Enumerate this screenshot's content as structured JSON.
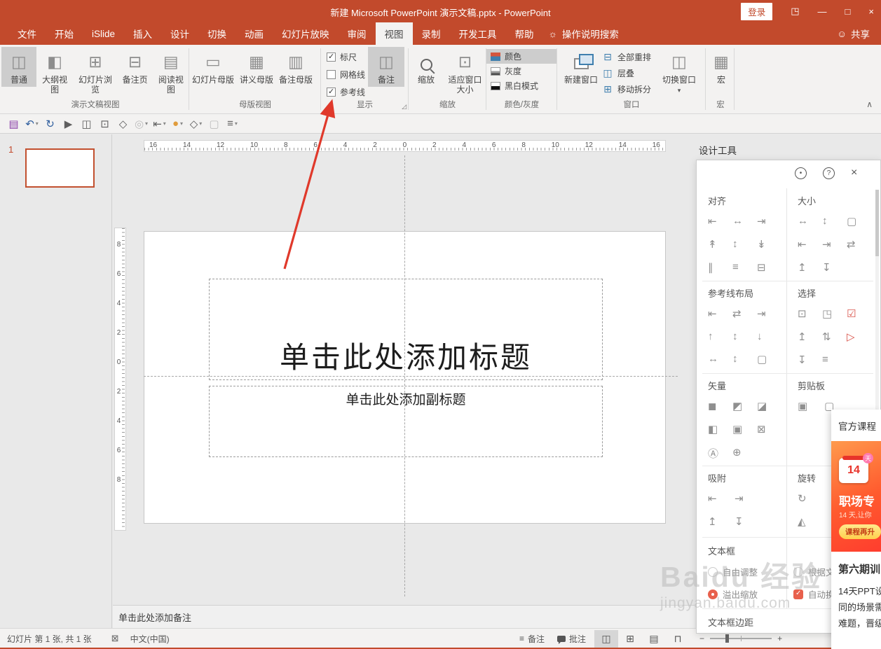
{
  "colors": {
    "titlebar": "#c24a2c",
    "accent": "#c24a2c",
    "selected_gray": "#cdcdcd",
    "panel_red": "#d9534a",
    "guide": "#a8a8a8",
    "promo_orange_start": "#ff9a4d",
    "promo_orange_end": "#ff3d2e",
    "promo_button": "#ffcf4d"
  },
  "titlebar": {
    "title": "新建 Microsoft PowerPoint 演示文稿.pptx  -  PowerPoint",
    "login": "登录",
    "controls": {
      "ribbon_display": "◳",
      "minimize": "—",
      "maximize": "□",
      "close": "×"
    }
  },
  "tabrow": {
    "tabs": [
      {
        "label": "文件"
      },
      {
        "label": "开始"
      },
      {
        "label": "iSlide"
      },
      {
        "label": "插入"
      },
      {
        "label": "设计"
      },
      {
        "label": "切换"
      },
      {
        "label": "动画"
      },
      {
        "label": "幻灯片放映"
      },
      {
        "label": "审阅"
      },
      {
        "label": "视图",
        "mod": "active"
      },
      {
        "label": "录制"
      },
      {
        "label": "开发工具"
      },
      {
        "label": "帮助"
      }
    ],
    "search": {
      "icon": "☼",
      "label": "操作说明搜索"
    },
    "share": {
      "icon": "☺",
      "label": "共享"
    }
  },
  "ribbon": {
    "presentation_views": {
      "label": "演示文稿视图",
      "buttons": [
        {
          "label": "普通",
          "g": "◫",
          "mod": "selected",
          "name": "normal-view-button"
        },
        {
          "label": "大纲视图",
          "g": "◧",
          "name": "outline-view-button"
        },
        {
          "label": "幻灯片浏览",
          "g": "⊞",
          "name": "slide-sorter-button"
        },
        {
          "label": "备注页",
          "g": "⊟",
          "name": "notes-page-button"
        },
        {
          "label": "阅读视图",
          "g": "▤",
          "name": "reading-view-button"
        }
      ]
    },
    "master_views": {
      "label": "母版视图",
      "buttons": [
        {
          "label": "幻灯片母版",
          "g": "▭",
          "name": "slide-master-button"
        },
        {
          "label": "讲义母版",
          "g": "▦",
          "name": "handout-master-button"
        },
        {
          "label": "备注母版",
          "g": "▥",
          "name": "notes-master-button"
        }
      ]
    },
    "show": {
      "label": "显示",
      "checkboxes": [
        {
          "label": "标尺",
          "mod": "checked",
          "name": "ruler-checkbox"
        },
        {
          "label": "网格线",
          "name": "gridlines-checkbox"
        },
        {
          "label": "参考线",
          "mod": "checked",
          "name": "guides-checkbox"
        }
      ],
      "notes": {
        "label": "备注"
      },
      "launcher": "◿"
    },
    "zoom": {
      "label": "缩放",
      "zoom_label": "缩放",
      "fit_label": "适应窗口大小",
      "fit_g": "⊡"
    },
    "color_gray": {
      "label": "颜色/灰度",
      "items_color": "颜色",
      "items_gray": "灰度",
      "items_bw": "黑白模式"
    },
    "window": {
      "label": "窗口",
      "new_window": "新建窗口",
      "items": [
        {
          "label": "全部重排",
          "g": "⊟",
          "name": "arrange-all-button"
        },
        {
          "label": "层叠",
          "g": "◫",
          "name": "cascade-button"
        },
        {
          "label": "移动拆分",
          "g": "⊞",
          "name": "move-split-button"
        }
      ],
      "switch_label": "切换窗口",
      "caret": "▾"
    },
    "macro": {
      "label": "宏",
      "button": "宏",
      "g": "▦"
    },
    "collapse": "∧"
  },
  "qat": {
    "items": [
      {
        "g": "▤",
        "name": "save-icon",
        "mod": "purple"
      },
      {
        "g": "↶",
        "name": "undo-icon",
        "mod": "blue caret"
      },
      {
        "g": "↻",
        "name": "redo-icon",
        "mod": "blue"
      },
      {
        "g": "▶",
        "name": "start-slideshow-icon"
      },
      {
        "g": "◫",
        "name": "notes-icon"
      },
      {
        "g": "⊡",
        "name": "display-settings-icon"
      },
      {
        "g": "◇",
        "name": "shapes-icon"
      },
      {
        "g": "◎",
        "name": "merge-shapes-icon",
        "mod": "dim caret"
      },
      {
        "g": "⇤",
        "name": "align-icon",
        "mod": "caret"
      },
      {
        "g": "●",
        "name": "bullet-color-icon",
        "mod": "orange caret"
      },
      {
        "g": "◇",
        "name": "shape-outline-icon",
        "mod": "caret"
      },
      {
        "g": "▢",
        "name": "placeholder-icon",
        "mod": "dim"
      },
      {
        "g": "≡",
        "name": "customize-qat-icon",
        "mod": "caret"
      }
    ]
  },
  "thumbnails": {
    "slide_number": "1"
  },
  "rulers": {
    "horizontal": [
      "16",
      "14",
      "12",
      "10",
      "8",
      "6",
      "4",
      "2",
      "0",
      "2",
      "4",
      "6",
      "8",
      "10",
      "12",
      "14",
      "16"
    ],
    "vertical": [
      "8",
      "6",
      "4",
      "2",
      "0",
      "2",
      "4",
      "6",
      "8"
    ]
  },
  "slide": {
    "title_placeholder": "单击此处添加标题",
    "subtitle_placeholder": "单击此处添加副标题"
  },
  "notes": {
    "placeholder": "单击此处添加备注"
  },
  "statusbar": {
    "slide_indicator": "幻灯片 第 1 张, 共 1 张",
    "proof_icon": "⊠",
    "language": "中文(中国)",
    "notes_label": "备注",
    "comments_label": "批注",
    "views": [
      {
        "g": "◫",
        "name": "statusbar-normal-view-button",
        "mod": "active"
      },
      {
        "g": "⊞",
        "name": "statusbar-slide-sorter-button"
      },
      {
        "g": "▤",
        "name": "statusbar-reading-view-button"
      },
      {
        "g": "⊓",
        "name": "statusbar-slideshow-button"
      }
    ],
    "zoom_out": "−",
    "zoom_in": "+"
  },
  "design_panel": {
    "tab_title": "设计工具",
    "header": {
      "settings": "•",
      "help": "?",
      "close": "×"
    },
    "sections": {
      "align": {
        "title": "对齐",
        "icons": [
          "⇤",
          "↔",
          "⇥",
          "↟",
          "↕",
          "↡",
          "∥",
          "≡",
          "⊟"
        ]
      },
      "size": {
        "title": "大小",
        "icons": [
          "↔",
          "↕",
          "▢",
          "⇤",
          "⇥",
          "⇄",
          "↥",
          "↧"
        ]
      },
      "guides": {
        "title": "参考线布局",
        "icons": [
          "⇤",
          "⇄",
          "⇥",
          "↑",
          "↕",
          "↓",
          "↔",
          "↕",
          "▢"
        ]
      },
      "selection": {
        "title": "选择",
        "icons": [
          {
            "g": "⊡"
          },
          {
            "g": "◳"
          },
          {
            "g": "☑",
            "mod": "red"
          },
          {
            "g": "↥"
          },
          {
            "g": "⇅"
          },
          {
            "g": "▷",
            "mod": "red"
          },
          {
            "g": "↧"
          },
          {
            "g": "≡"
          }
        ]
      },
      "vector": {
        "title": "矢量",
        "icons": [
          "◼",
          "◩",
          "◪",
          "◧",
          "▣",
          "⊠",
          "Ⓐ",
          "⊕"
        ]
      },
      "clipboard": {
        "title": "剪贴板",
        "icons": [
          "▣",
          "▢"
        ]
      },
      "snap": {
        "title": "吸附",
        "icons": [
          "⇤",
          "⇥",
          "↥",
          "↧"
        ]
      },
      "rotate": {
        "title": "旋转",
        "icons": [
          "↻",
          "◭"
        ]
      },
      "textbox": {
        "title": "文本框",
        "options": [
          {
            "label": "自由调整",
            "mod": "radio"
          },
          {
            "label": "根据文",
            "mod": "radio"
          },
          {
            "label": "溢出缩放",
            "mod": "radio on"
          },
          {
            "label": "自动换行",
            "mod": "check on"
          }
        ],
        "footer": "文本框边距"
      }
    }
  },
  "watermark": {
    "brand": "Baidu 经验",
    "url": "jingyan.baidu.com"
  },
  "promo": {
    "header": "官方课程",
    "badge_num": "14",
    "badge_unit": "天",
    "banner_title": "职场专",
    "banner_sub": "14 天,让你",
    "button": "课程再升",
    "card_title": "第六期训",
    "lines": [
      "14天PPT设",
      "同的场景需",
      "难题，晋级"
    ]
  }
}
